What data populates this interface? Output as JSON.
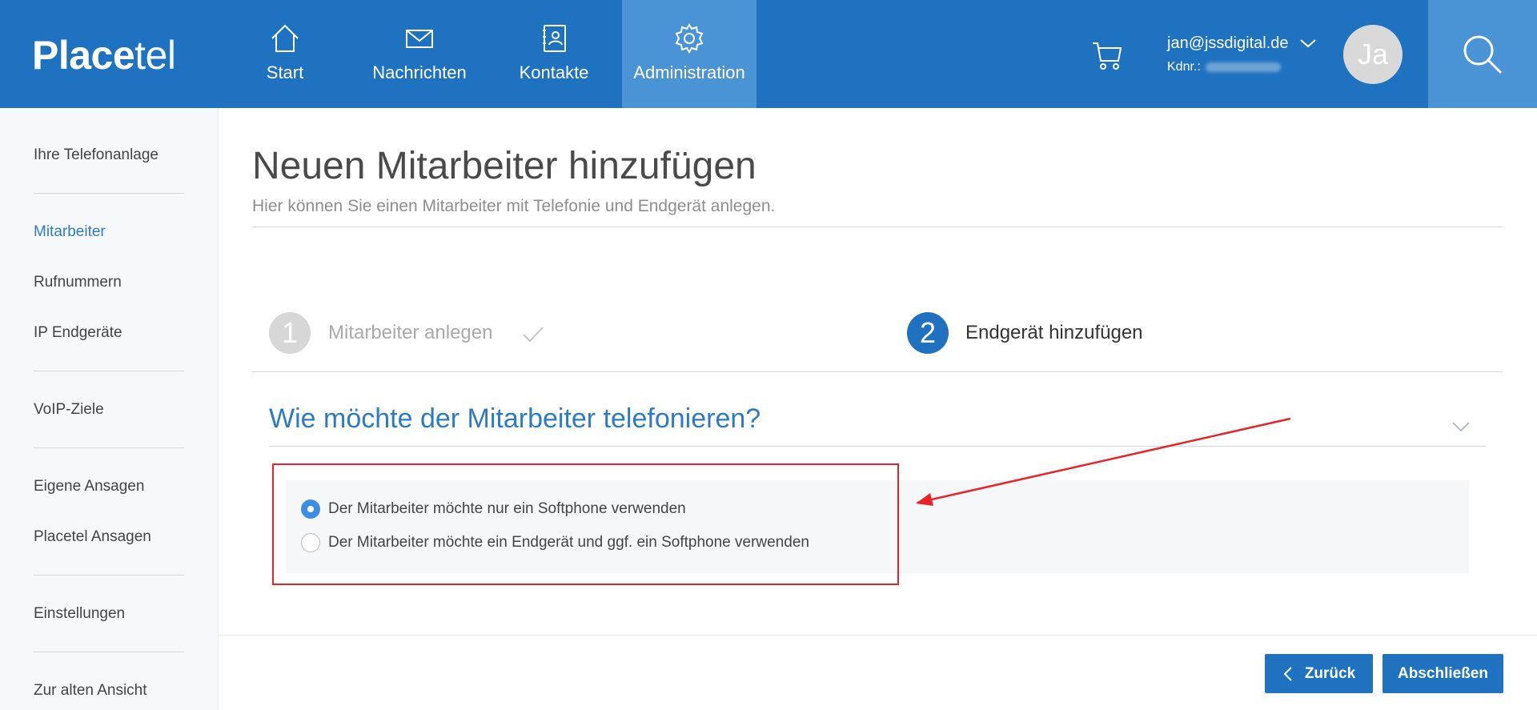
{
  "brand": {
    "logo_bold": "Place",
    "logo_light": "tel"
  },
  "nav": {
    "start": "Start",
    "messages": "Nachrichten",
    "contacts": "Kontakte",
    "admin": "Administration"
  },
  "user": {
    "email": "jan@jssdigital.de",
    "kdnr_label": "Kdnr.:",
    "initials": "Ja"
  },
  "sidebar": {
    "items": [
      {
        "label": "Ihre Telefonanlage"
      },
      {
        "label": "Mitarbeiter"
      },
      {
        "label": "Rufnummern"
      },
      {
        "label": "IP Endgeräte"
      },
      {
        "label": "VoIP-Ziele"
      },
      {
        "label": "Eigene Ansagen"
      },
      {
        "label": "Placetel Ansagen"
      },
      {
        "label": "Einstellungen"
      },
      {
        "label": "Zur alten Ansicht"
      }
    ]
  },
  "page": {
    "title": "Neuen Mitarbeiter hinzufügen",
    "subtitle": "Hier können Sie einen Mitarbeiter mit Telefonie und Endgerät anlegen."
  },
  "steps": [
    {
      "number": "1",
      "label": "Mitarbeiter anlegen"
    },
    {
      "number": "2",
      "label": "Endgerät hinzufügen"
    }
  ],
  "question": "Wie möchte der Mitarbeiter telefonieren?",
  "options": [
    {
      "label": "Der Mitarbeiter möchte nur ein Softphone verwenden",
      "checked": true
    },
    {
      "label": "Der Mitarbeiter möchte ein Endgerät und ggf. ein Softphone verwenden",
      "checked": false
    }
  ],
  "buttons": {
    "back": "Zurück",
    "finish": "Abschließen"
  },
  "colors": {
    "primary": "#1f72bf",
    "active_nav": "#4a93d4",
    "annotation": "#e8232a"
  }
}
